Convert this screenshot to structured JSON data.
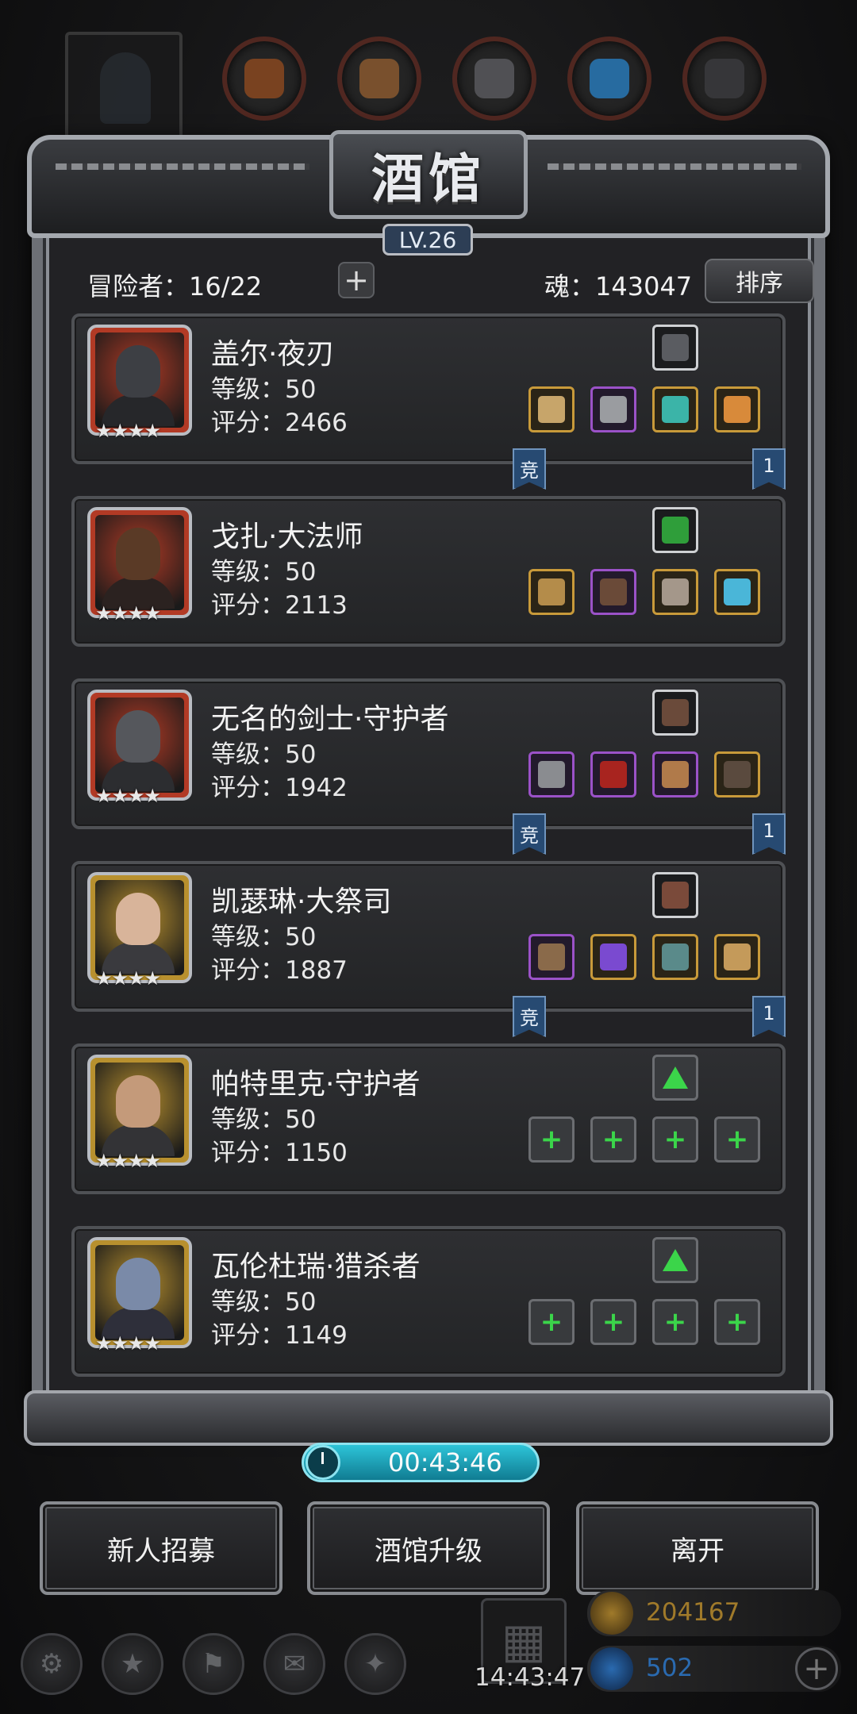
{
  "resources": {
    "items": [
      {
        "icon": "copper-ore-icon",
        "value": "",
        "color": "#8a4a22"
      },
      {
        "icon": "wood-plank-icon",
        "value": "",
        "color": "#8a5a30"
      },
      {
        "icon": "iron-ingot-icon",
        "value": "",
        "color": "#5a5a5e"
      },
      {
        "icon": "blue-crystal-icon",
        "value": "",
        "color": "#2a7ab8"
      },
      {
        "icon": "dark-ore-icon",
        "value": "",
        "color": "#3d3d40"
      }
    ]
  },
  "panel": {
    "title": "酒馆",
    "level": "LV.26",
    "adventurer_label": "冒险者：16/22",
    "add_label": "+",
    "soul_label": "魂：143047",
    "sort_label": "排序"
  },
  "heroes": [
    {
      "name": "盖尔·夜刃",
      "level": "等级：50",
      "score": "评分：2466",
      "stars": "★★★★",
      "frame": "#b23a25",
      "skin": "#3d3f44",
      "body": "#26272a",
      "badge": {
        "icon": "glove-icon",
        "color": "#5a5c61"
      },
      "equipment": [
        {
          "icon": "spear-icon",
          "rarity": "gold",
          "color": "#c7a56a"
        },
        {
          "icon": "chest-armor-icon",
          "rarity": "purple",
          "color": "#9a9ca0"
        },
        {
          "icon": "gem-icon",
          "rarity": "gold",
          "color": "#3bb4a8"
        },
        {
          "icon": "ring-icon",
          "rarity": "gold",
          "color": "#d88a3a"
        }
      ],
      "ribbons": [
        "竞",
        "1"
      ]
    },
    {
      "name": "戈扎·大法师",
      "level": "等级：50",
      "score": "评分：2113",
      "stars": "★★★★",
      "frame": "#b23a25",
      "skin": "#5a3a26",
      "body": "#2b2220",
      "badge": {
        "icon": "spellbook-icon",
        "color": "#2f9e3a"
      },
      "equipment": [
        {
          "icon": "staff-icon",
          "rarity": "gold",
          "color": "#b48c4a"
        },
        {
          "icon": "robe-icon",
          "rarity": "purple",
          "color": "#6a4a38"
        },
        {
          "icon": "mask-icon",
          "rarity": "gold",
          "color": "#a4978a"
        },
        {
          "icon": "rune-ring-icon",
          "rarity": "gold",
          "color": "#4ab6d8"
        }
      ],
      "ribbons": []
    },
    {
      "name": "无名的剑士·守护者",
      "level": "等级：50",
      "score": "评分：1942",
      "stars": "★★★★",
      "frame": "#b23a25",
      "skin": "#55575c",
      "body": "#2c2d30",
      "badge": {
        "icon": "gauntlet-icon",
        "color": "#6a4a3a"
      },
      "equipment": [
        {
          "icon": "greatsword-icon",
          "rarity": "purple",
          "color": "#8a8c90"
        },
        {
          "icon": "hood-icon",
          "rarity": "purple",
          "color": "#a8241f"
        },
        {
          "icon": "shield-icon",
          "rarity": "purple",
          "color": "#b07a4a"
        },
        {
          "icon": "cloak-icon",
          "rarity": "gold",
          "color": "#5a4a3e"
        }
      ],
      "ribbons": [
        "竞",
        "1"
      ]
    },
    {
      "name": "凯瑟琳·大祭司",
      "level": "等级：50",
      "score": "评分：1887",
      "stars": "★★★★",
      "frame": "#b8902e",
      "skin": "#d8b49a",
      "body": "#3a3a3e",
      "badge": {
        "icon": "feather-quill-icon",
        "color": "#7a4a3a"
      },
      "equipment": [
        {
          "icon": "hammer-icon",
          "rarity": "purple",
          "color": "#8a6a4a"
        },
        {
          "icon": "mage-armor-icon",
          "rarity": "gold",
          "color": "#7a4ad0"
        },
        {
          "icon": "band-ring-icon",
          "rarity": "gold",
          "color": "#5a8a8a"
        },
        {
          "icon": "amulet-icon",
          "rarity": "gold",
          "color": "#c49a5a"
        }
      ],
      "ribbons": [
        "竞",
        "1"
      ]
    },
    {
      "name": "帕特里克·守护者",
      "level": "等级：50",
      "score": "评分：1150",
      "stars": "★★★★",
      "frame": "#b8902e",
      "skin": "#c49a7a",
      "body": "#333336",
      "badge": {
        "icon": "empty-slot-icon",
        "color": "#3bd54a"
      },
      "equipment": [
        {
          "icon": "empty-weapon-slot-icon",
          "rarity": "empty",
          "color": "#3bd54a"
        },
        {
          "icon": "empty-armor-slot-icon",
          "rarity": "empty",
          "color": "#3bd54a"
        },
        {
          "icon": "empty-accessory-slot-icon",
          "rarity": "empty",
          "color": "#3bd54a"
        },
        {
          "icon": "empty-accessory-slot-icon",
          "rarity": "empty",
          "color": "#3bd54a"
        }
      ],
      "ribbons": []
    },
    {
      "name": "瓦伦杜瑞·猎杀者",
      "level": "等级：50",
      "score": "评分：1149",
      "stars": "★★★★",
      "frame": "#b8902e",
      "skin": "#7a8aa8",
      "body": "#2e2f3a",
      "badge": {
        "icon": "empty-slot-icon",
        "color": "#3bd54a"
      },
      "equipment": [
        {
          "icon": "empty-weapon-slot-icon",
          "rarity": "empty",
          "color": "#3bd54a"
        },
        {
          "icon": "empty-armor-slot-icon",
          "rarity": "empty",
          "color": "#3bd54a"
        },
        {
          "icon": "empty-accessory-slot-icon",
          "rarity": "empty",
          "color": "#3bd54a"
        },
        {
          "icon": "empty-accessory-slot-icon",
          "rarity": "empty",
          "color": "#3bd54a"
        }
      ],
      "ribbons": []
    }
  ],
  "timer": "00:43:46",
  "actions": {
    "recruit": "新人招募",
    "upgrade": "酒馆升级",
    "leave": "离开"
  },
  "hud": {
    "clock": "14:43:47",
    "gold": "204167",
    "gems": "502",
    "gold_color": "#a07a2a",
    "gem_color": "#2a6ab0"
  }
}
